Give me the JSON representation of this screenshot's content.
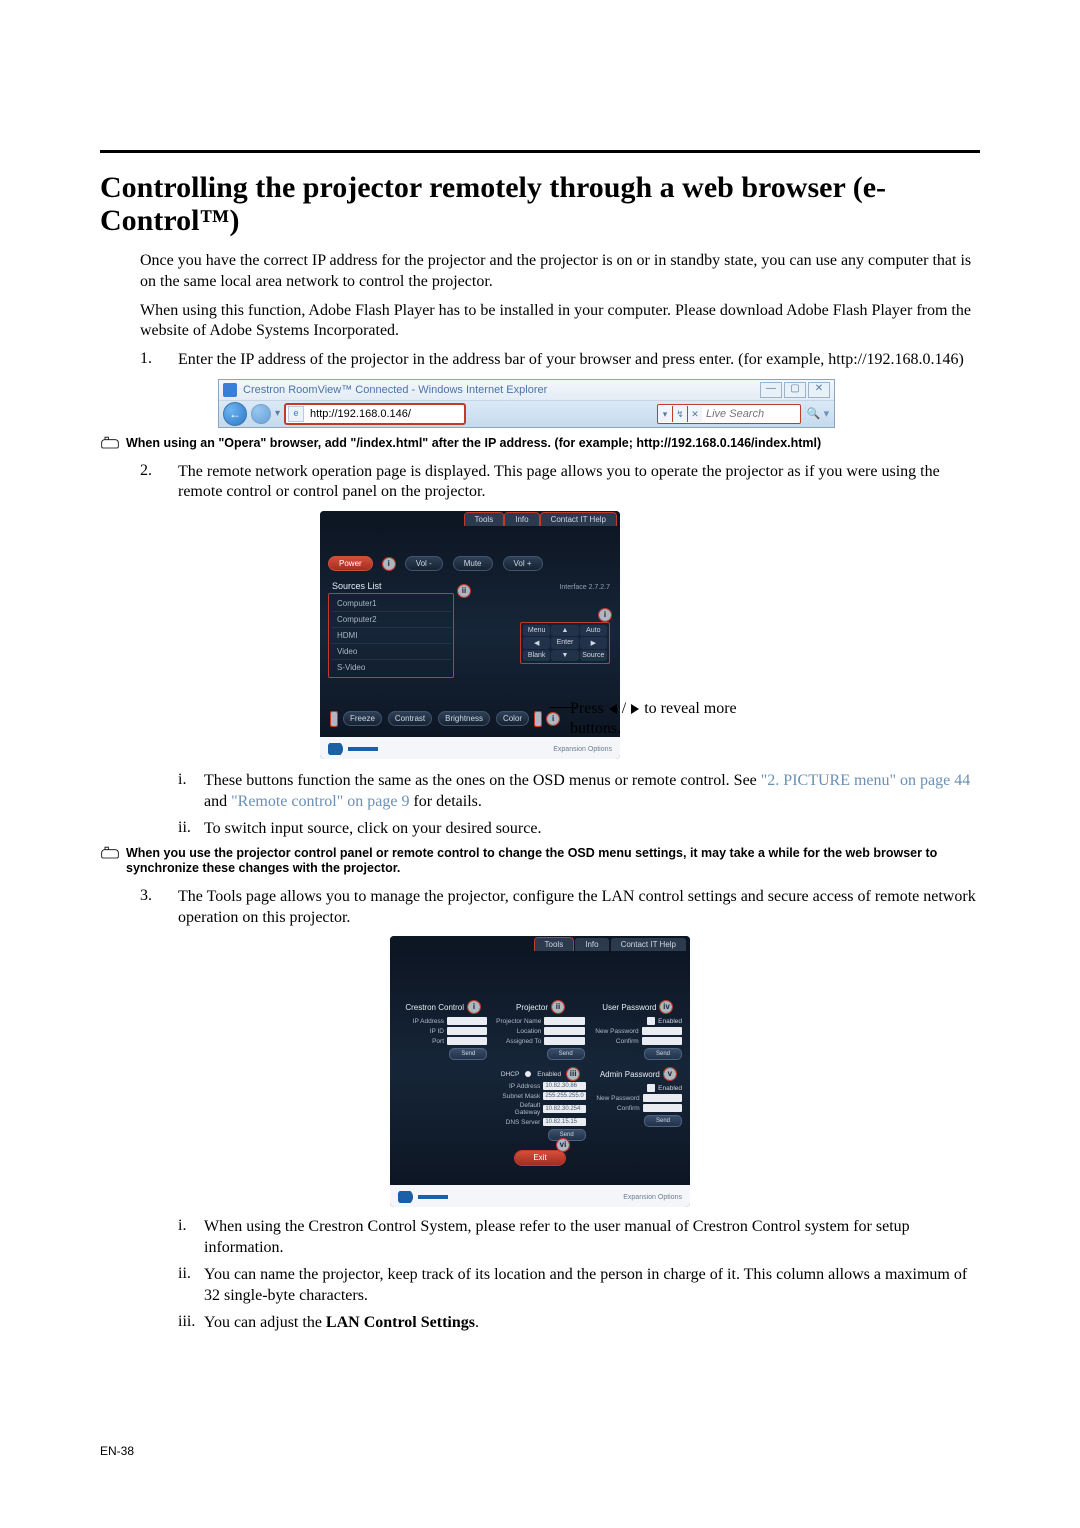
{
  "page_number": "EN-38",
  "heading": "Controlling the projector remotely through a web browser (e-Control™)",
  "intro_p1": "Once you have the correct IP address for the projector and the projector is on or in standby state, you can use any computer that is on the same local area network to control the projector.",
  "intro_p2": "When using this function, Adobe Flash Player has to be installed in your computer. Please download Adobe Flash Player from the website of Adobe Systems Incorporated.",
  "step1": "Enter the IP address of the projector in the address bar of your browser and press enter. (for example, http://192.168.0.146)",
  "browser": {
    "title": "Crestron RoomView™ Connected - Windows Internet Explorer",
    "address": "http://192.168.0.146/",
    "addr_icon": "e",
    "search_placeholder": "Live Search",
    "win_btns": [
      "—",
      "▢",
      "✕"
    ],
    "nav_back": "←",
    "nav_fwd": "",
    "dropdown": "▾",
    "search_tabs": [
      "▾",
      "↯",
      "✕"
    ],
    "magnifier": "🔍 ▾"
  },
  "note1": "When using an \"Opera\" browser, add \"/index.html\" after the IP address. (for example; http://192.168.0.146/index.html)",
  "step2": "The remote network operation page is displayed. This page allows you to operate the projector as if you were using the remote control or control panel on the projector.",
  "roomview1": {
    "tabs": [
      "Tools",
      "Info",
      "Contact IT Help"
    ],
    "interface": "Interface 2.7.2.7",
    "top_buttons": [
      "Power",
      "Vol -",
      "Mute",
      "Vol +"
    ],
    "badge_i": "i",
    "sources_title": "Sources List",
    "sources": [
      "Computer1",
      "Computer2",
      "HDMI",
      "Video",
      "S-Video"
    ],
    "badge_ii": "ii",
    "dpad": [
      "Menu",
      "▲",
      "Auto",
      "◀",
      "Enter",
      "▶",
      "Blank",
      "▼",
      "Source"
    ],
    "bottom_buttons": [
      "Freeze",
      "Contrast",
      "Brightness",
      "Color"
    ],
    "footer_link": "Expansion Options",
    "annot": [
      "Press ",
      " / ",
      " to reveal more buttons."
    ]
  },
  "step2_i_pre": "These buttons function the same as the ones on the OSD menus or remote control. See ",
  "step2_i_link1": "\"2. PICTURE menu\" on page 44",
  "step2_i_mid": " and ",
  "step2_i_link2": "\"Remote control\" on page 9",
  "step2_i_post": " for details.",
  "step2_ii": "To switch input source, click on your desired source.",
  "note2": "When you use the projector control panel or remote control to change the OSD menu settings, it may take a while for the web browser to synchronize these changes with the projector.",
  "step3": "The Tools page allows you to manage the projector, configure the LAN control settings and secure access of remote network operation on this projector.",
  "toolspage": {
    "tabs": [
      "Tools",
      "Info",
      "Contact IT Help"
    ],
    "col1_title": "Crestron Control",
    "col2_title": "Projector",
    "col3_title": "User Password",
    "col1_labels": [
      "IP Address",
      "IP ID",
      "Port"
    ],
    "col2_labels": [
      "Projector Name",
      "Location",
      "Assigned To"
    ],
    "enabled_label": "Enabled",
    "new_pw": "New Password",
    "confirm": "Confirm",
    "send": "Send",
    "dhcp_label": "DHCP",
    "dhcp_opt": "Enabled",
    "net_labels": [
      "IP Address",
      "Subnet Mask",
      "Default Gateway",
      "DNS Server"
    ],
    "net_vals": [
      "10.82.30.86",
      "255.255.255.0",
      "10.82.30.254",
      "10.82.15.15"
    ],
    "col3b_title": "Admin Password",
    "exit": "Exit",
    "footer_link": "Expansion Options",
    "badge_i": "i",
    "badge_ii": "ii",
    "badge_iii": "iii",
    "badge_iv": "iv",
    "badge_v": "v",
    "badge_vi": "vi"
  },
  "step3_i": "When using the Crestron Control System, please refer to the user manual of Crestron Control system for setup information.",
  "step3_ii": "You can name the projector, keep track of its location and the person in charge of it. This column allows a maximum of 32 single-byte characters.",
  "step3_iii_pre": "You can adjust the ",
  "step3_iii_bold": "LAN Control Settings",
  "step3_iii_post": "."
}
